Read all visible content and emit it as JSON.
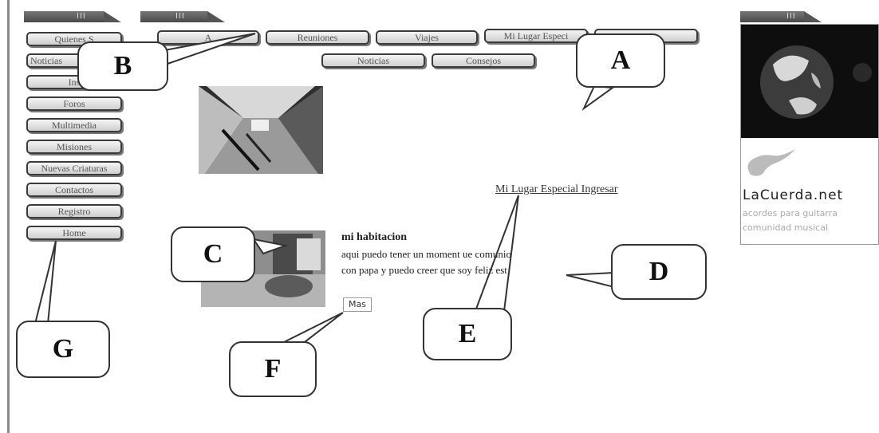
{
  "sidebar": {
    "items": [
      {
        "label": "Quienes S"
      },
      {
        "label": "Noticias"
      },
      {
        "label": "Ins"
      },
      {
        "label": "Foros"
      },
      {
        "label": "Multimedia"
      },
      {
        "label": "Misiones"
      },
      {
        "label": "Nuevas Criaturas"
      },
      {
        "label": "Contactos"
      },
      {
        "label": "Registro"
      },
      {
        "label": "Home"
      }
    ]
  },
  "topnav": {
    "row1": [
      {
        "label": "A"
      },
      {
        "label": "Reuniones"
      },
      {
        "label": "Viajes"
      },
      {
        "label": "Mi Lugar Especi"
      },
      {
        "label": ""
      }
    ],
    "row2": [
      {
        "label": "Noticias"
      },
      {
        "label": "Consejos"
      }
    ]
  },
  "post": {
    "title": "mi habitacion",
    "line1": "aqui puedo tener un moment   ue comunio",
    "line2": "con papa y puedo creer que   soy feliz est",
    "more_label": "Mas"
  },
  "special_link": "Mi Lugar Especial Ingresar",
  "ad": {
    "brand": "LaCuerda.net",
    "tagline1": "acordes para guitarra",
    "tagline2": "comunidad musical"
  },
  "callouts": {
    "a": "A",
    "b": "B",
    "c": "C",
    "d": "D",
    "e": "E",
    "f": "F",
    "g": "G"
  },
  "tab_marks": "III"
}
